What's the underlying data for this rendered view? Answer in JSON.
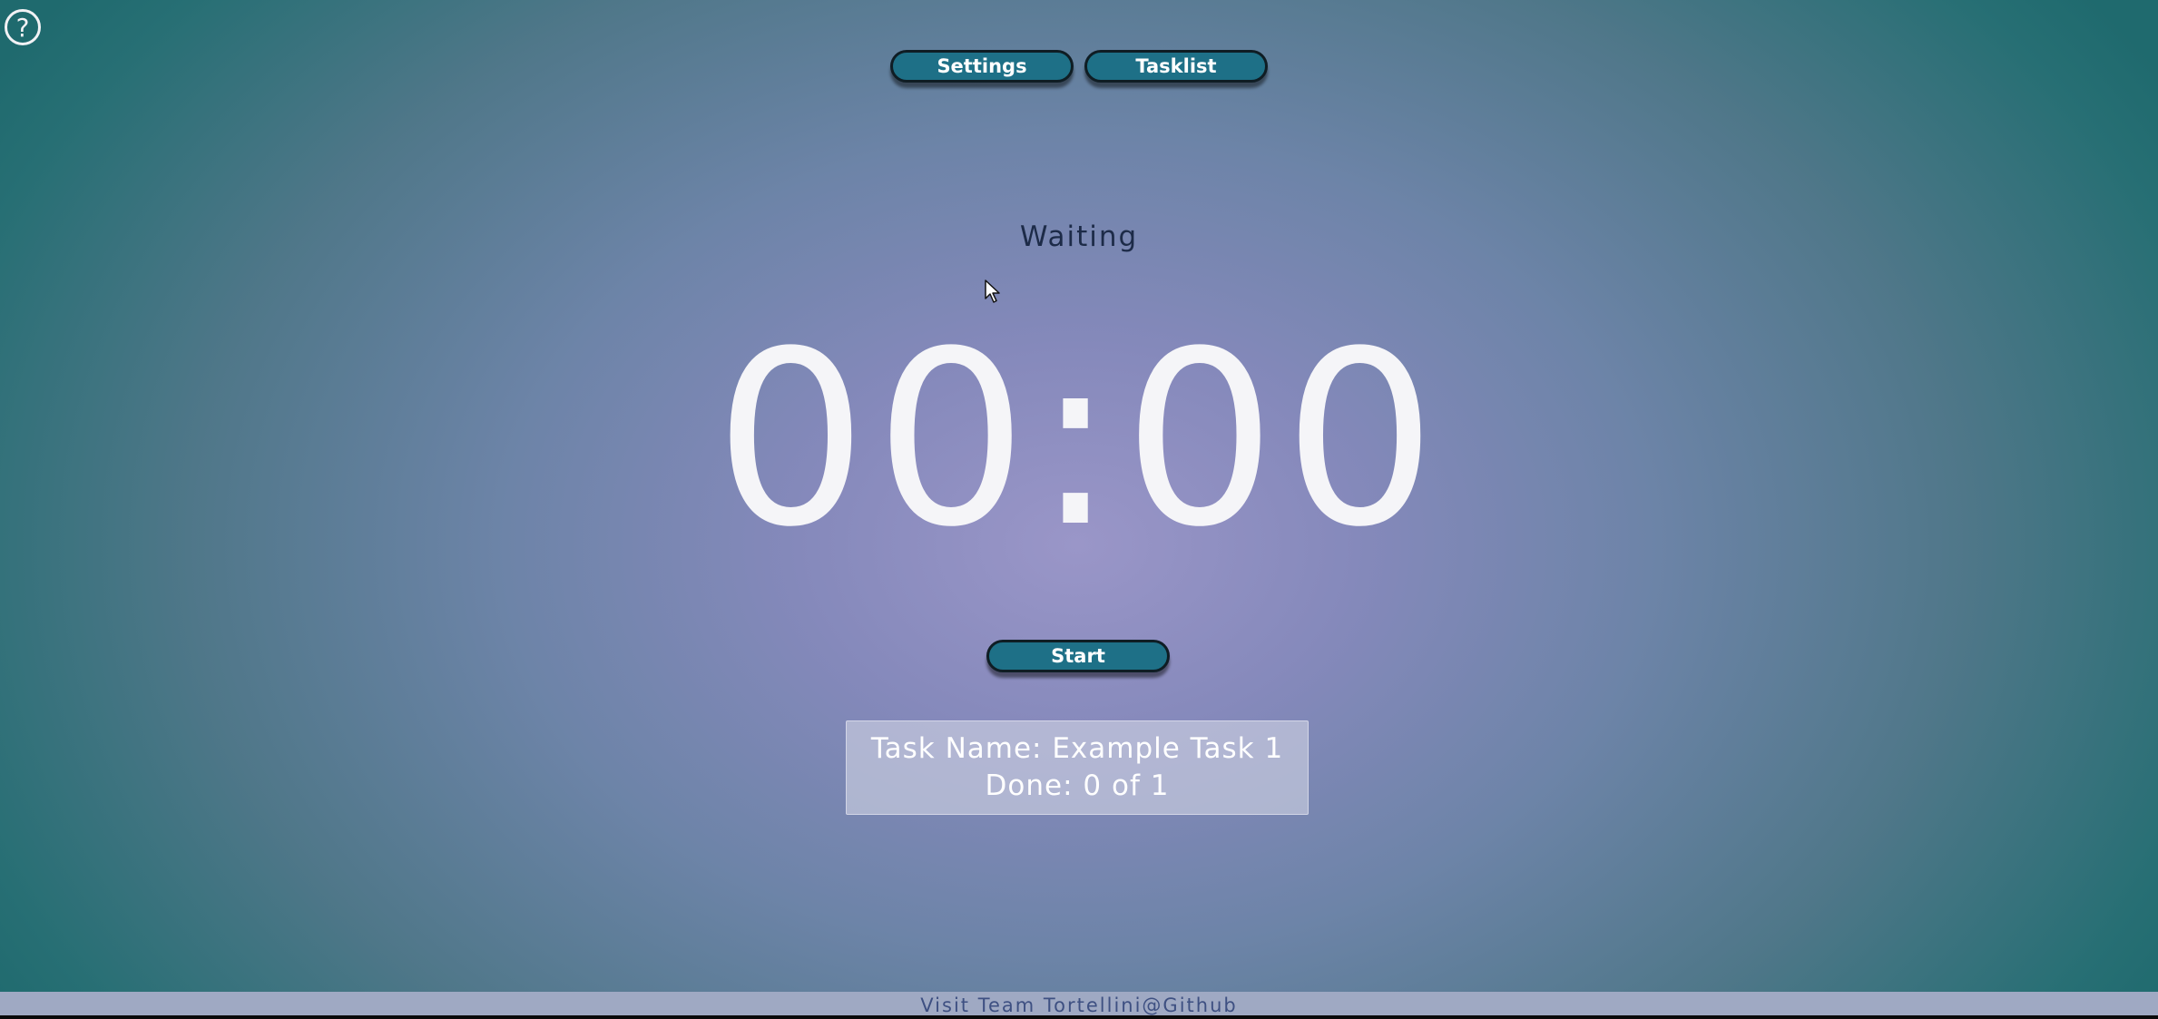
{
  "help": {
    "icon": "question-circle-icon",
    "glyph": "?"
  },
  "nav": {
    "settings_label": "Settings",
    "tasklist_label": "Tasklist"
  },
  "status": "Waiting",
  "timer": "00:00",
  "controls": {
    "start_label": "Start"
  },
  "task": {
    "name_line": "Task Name: Example Task 1",
    "done_line": "Done: 0 of 1"
  },
  "footer": {
    "link_text": "Visit Team Tortellini@Github"
  },
  "colors": {
    "button_bg": "#1e7087",
    "timer_text": "#f5f5f8",
    "status_text": "#1d2b48",
    "footer_bg": "#9fa9c3"
  }
}
